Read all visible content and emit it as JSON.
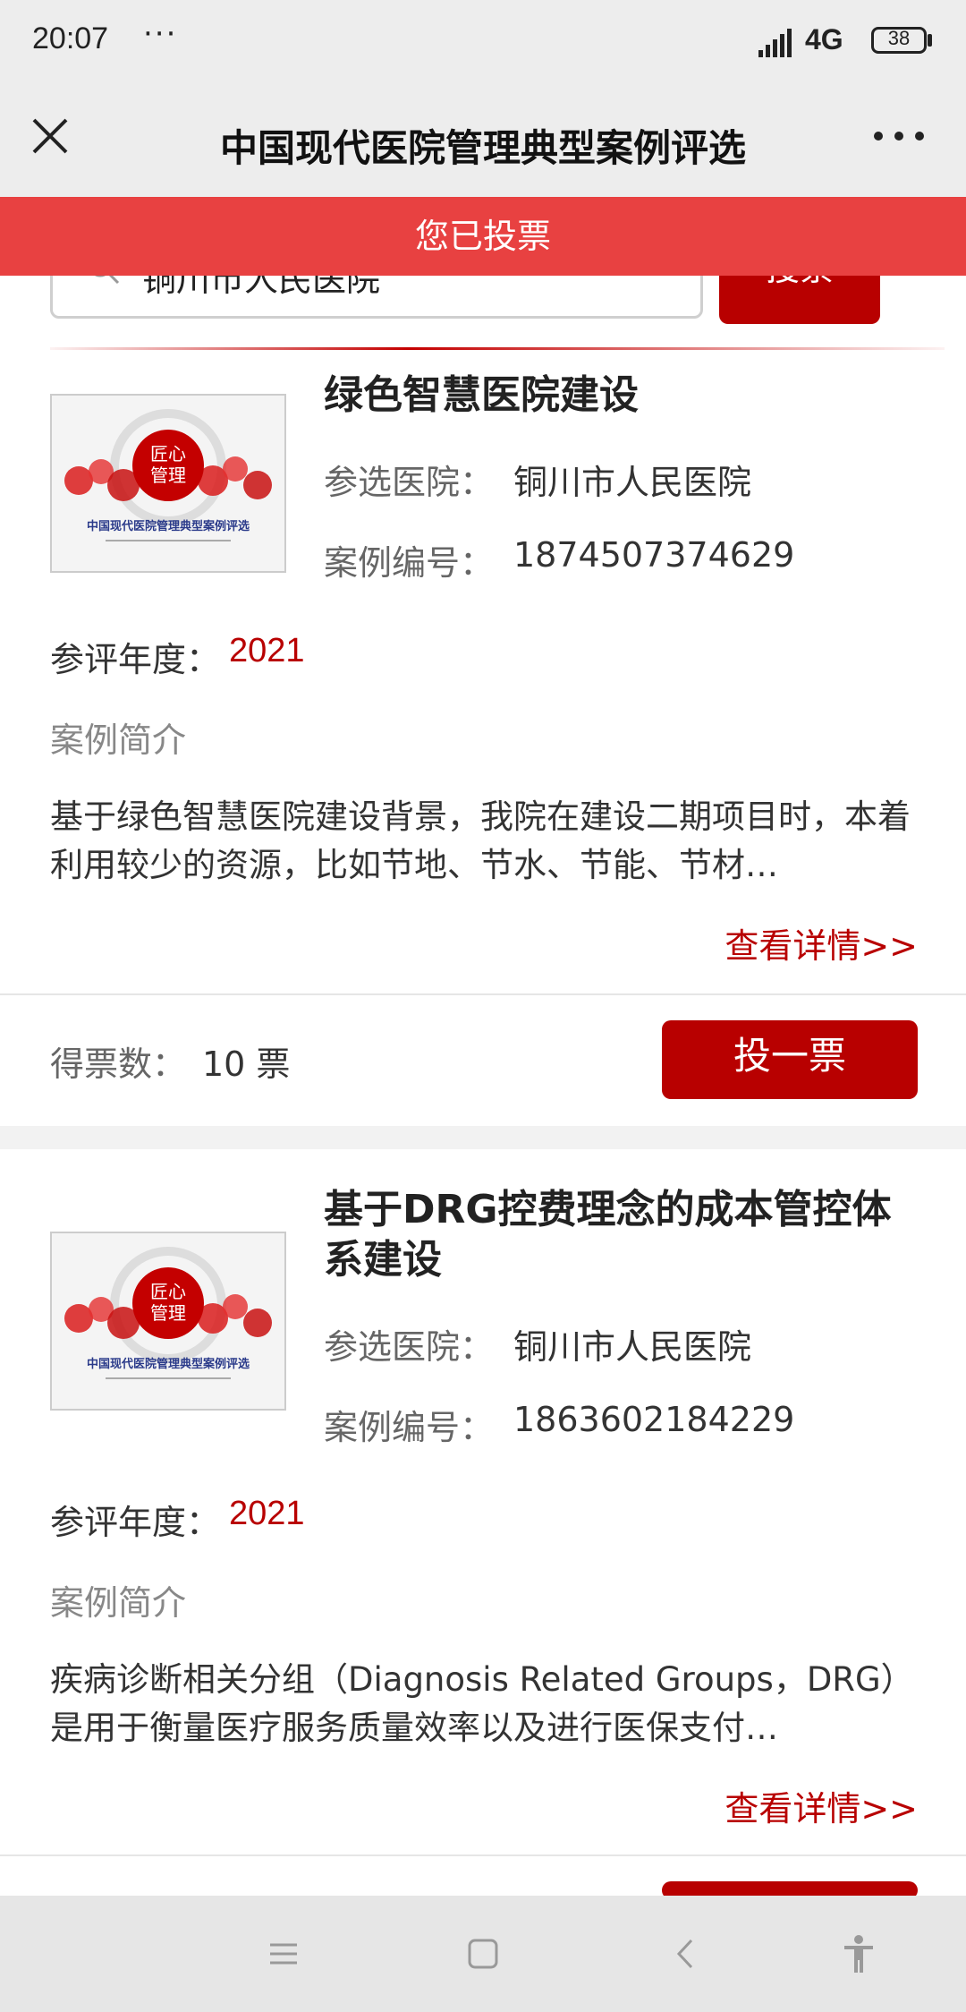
{
  "status_bar": {
    "time": "20:07",
    "dots": "···",
    "network": "4G",
    "battery": "38"
  },
  "header": {
    "title": "中国现代医院管理典型案例评选",
    "close_icon": "close-icon",
    "more_icon": "more-icon"
  },
  "banner": {
    "text": "您已投票"
  },
  "search": {
    "value": "铜川市人民医院",
    "button_label": "搜索"
  },
  "cases": [
    {
      "title": "绿色智慧医院建设",
      "hospital_label": "参选医院：",
      "hospital": "铜川市人民医院",
      "number_label": "案例编号：",
      "number": "1874507374629",
      "year_label": "参评年度：",
      "year": "2021",
      "intro_label": "案例简介",
      "intro": "基于绿色智慧医院建设背景，我院在建设二期项目时，本着利用较少的资源，比如节地、节水、节能、节材…",
      "detail_link": "查看详情>>",
      "votes_label": "得票数：",
      "votes": "10 票",
      "vote_button": "投一票"
    },
    {
      "title": "基于DRG控费理念的成本管控体系建设",
      "hospital_label": "参选医院：",
      "hospital": "铜川市人民医院",
      "number_label": "案例编号：",
      "number": "1863602184229",
      "year_label": "参评年度：",
      "year": "2021",
      "intro_label": "案例简介",
      "intro": "疾病诊断相关分组（Diagnosis Related Groups，DRG）是用于衡量医疗服务质量效率以及进行医保支付…",
      "detail_link": "查看详情>>"
    }
  ],
  "thumbnail": {
    "caption": "中国现代医院管理典型案例评选"
  },
  "colors": {
    "accent": "#b80000",
    "banner": "#e84141",
    "header_bg": "#ededed"
  },
  "navbar": {
    "icons": [
      "menu-icon",
      "home-icon",
      "back-icon",
      "accessibility-icon"
    ]
  }
}
